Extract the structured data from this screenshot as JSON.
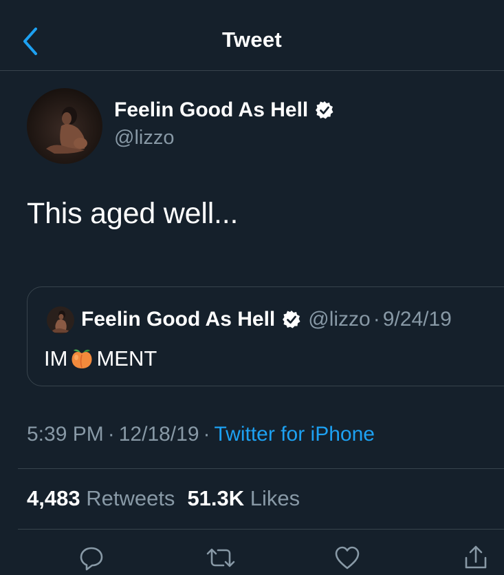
{
  "nav": {
    "title": "Tweet"
  },
  "tweet": {
    "display_name": "Feelin Good As Hell",
    "handle": "@lizzo",
    "text": "This aged well...",
    "time": "5:39 PM",
    "date": "12/18/19",
    "source": "Twitter for iPhone",
    "separator": "·"
  },
  "quote": {
    "display_name": "Feelin Good As Hell",
    "handle": "@lizzo",
    "dot": "·",
    "date": "9/24/19",
    "text_before": "IM",
    "text_after": "MENT"
  },
  "stats": {
    "retweets_count": "4,483",
    "retweets_label": "Retweets",
    "likes_count": "51.3K",
    "likes_label": "Likes"
  },
  "icons": {
    "back": "chevron-left",
    "verified": "verified-badge",
    "reply": "reply-bubble",
    "retweet": "retweet-arrows",
    "like": "heart",
    "share": "share-upload"
  },
  "colors": {
    "background": "#15202b",
    "accent": "#1da1f2",
    "secondary_text": "#8899a6",
    "divider": "#38444d"
  }
}
